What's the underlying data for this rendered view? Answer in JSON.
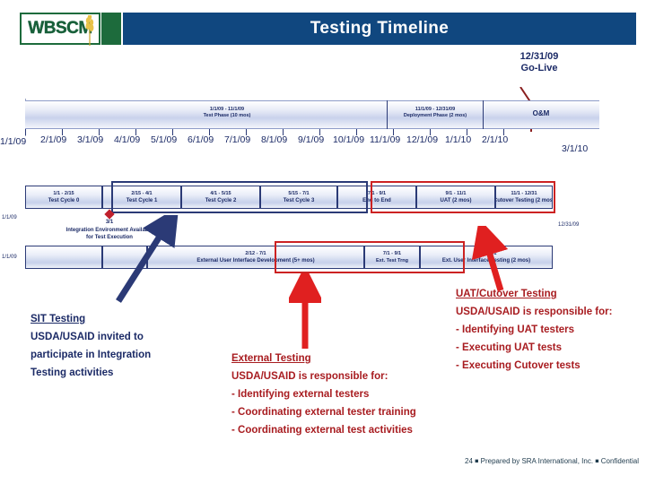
{
  "header": {
    "logo_text": "WBSCM",
    "title": "Testing Timeline"
  },
  "timeline": {
    "golive": {
      "date": "12/31/09",
      "label": "Go-Live"
    },
    "phases": [
      {
        "id": "test-phase",
        "range": "1/1/09 - 11/1/09",
        "name": "Test Phase (10 mos)"
      },
      {
        "id": "deployment-phase",
        "range": "11/1/09 - 12/31/09",
        "name": "Deployment Phase (2 mos)"
      },
      {
        "id": "om-phase",
        "range": "",
        "name": "O&M"
      }
    ],
    "axis_labels": [
      "1/1/09",
      "2/1/09",
      "3/1/09",
      "4/1/09",
      "5/1/09",
      "6/1/09",
      "7/1/09",
      "8/1/09",
      "9/1/09",
      "10/1/09",
      "11/1/09",
      "12/1/09",
      "1/1/10",
      "2/1/10",
      "3/1/10"
    ],
    "edge_dates": {
      "row1_left": "1/1/09",
      "row1_right": "12/31/09",
      "row2_left": "1/1/09"
    },
    "milestone": {
      "date": "3/1",
      "text": "Integration Environment Available for Test Execution"
    },
    "row1": [
      {
        "range": "1/1 - 2/15",
        "name": "Test Cycle 0"
      },
      {
        "range": "2/15 - 4/1",
        "name": "Test Cycle 1"
      },
      {
        "range": "4/1 - 5/15",
        "name": "Test Cycle 2"
      },
      {
        "range": "5/15 - 7/1",
        "name": "Test Cycle 3"
      },
      {
        "range": "7/1 - 9/1",
        "name": "End to End"
      },
      {
        "range": "9/1 - 11/1",
        "name": "UAT (2 mos)"
      },
      {
        "range": "11/1 - 12/31",
        "name": "Cutover Testing (2 mos)"
      }
    ],
    "row2": [
      {
        "range": "",
        "name": ""
      },
      {
        "range": "",
        "name": ""
      },
      {
        "range": "2/12 - 7/1",
        "name": "External User Interface Development (5+ mos)"
      },
      {
        "range": "7/1 - 9/1",
        "name": "Ext. Test Trng"
      },
      {
        "range": "9/1 - 11/1",
        "name": "Ext. User Interface Testing (2 mos)"
      }
    ]
  },
  "callouts": {
    "sit": {
      "heading": "SIT Testing",
      "lines": [
        "USDA/USAID invited to",
        "participate in Integration",
        "Testing activities"
      ]
    },
    "external": {
      "heading": "External Testing",
      "lines": [
        "USDA/USAID is responsible for:",
        "- Identifying external testers",
        "- Coordinating external tester training",
        "- Coordinating external test activities"
      ]
    },
    "uat": {
      "heading": "UAT/Cutover Testing",
      "lines": [
        "USDA/USAID is responsible for:",
        "- Identifying UAT testers",
        "- Executing UAT tests",
        "- Executing Cutover tests"
      ]
    }
  },
  "footer": {
    "page_number": "24",
    "prepared_by": "Prepared by SRA International, Inc.",
    "classification": "Confidential"
  },
  "colors": {
    "brand_blue": "#10477f",
    "brand_green": "#1d6b3c",
    "navy_text": "#1b2a66",
    "red_text": "#a81c20",
    "red_box": "#cc2222"
  }
}
